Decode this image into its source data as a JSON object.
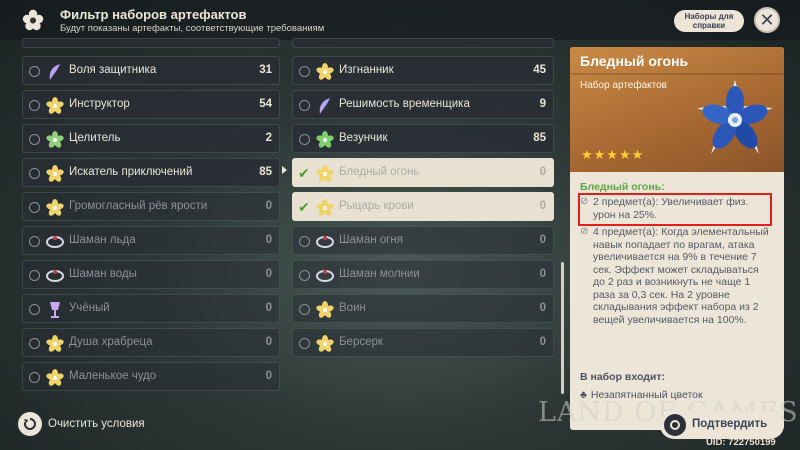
{
  "header": {
    "title": "Фильтр наборов артефактов",
    "subtitle": "Будут показаны артефакты, соответствующие требованиям",
    "help_label": "Наборы для справки",
    "app_icon": "flower-icon",
    "close_icon": "close-icon"
  },
  "left_list": [
    {
      "label": "Воля защитника",
      "count": "31",
      "icon": "feather-icon",
      "state": "normal"
    },
    {
      "label": "Инструктор",
      "count": "54",
      "icon": "flower-icon",
      "state": "normal"
    },
    {
      "label": "Целитель",
      "count": "2",
      "icon": "leaf-icon",
      "state": "normal"
    },
    {
      "label": "Искатель приключений",
      "count": "85",
      "icon": "flower-icon",
      "state": "normal"
    },
    {
      "label": "Громогласный рёв ярости",
      "count": "0",
      "icon": "flower-icon",
      "state": "disabled"
    },
    {
      "label": "Шаман льда",
      "count": "0",
      "icon": "circlet-icon",
      "state": "disabled"
    },
    {
      "label": "Шаман воды",
      "count": "0",
      "icon": "circlet-icon",
      "state": "disabled"
    },
    {
      "label": "Учёный",
      "count": "0",
      "icon": "goblet-icon",
      "state": "disabled"
    },
    {
      "label": "Душа храбреца",
      "count": "0",
      "icon": "flower-icon",
      "state": "disabled"
    },
    {
      "label": "Маленькое чудо",
      "count": "0",
      "icon": "flower-icon",
      "state": "disabled"
    }
  ],
  "right_list": [
    {
      "label": "Изгнанник",
      "count": "45",
      "icon": "flower-icon",
      "state": "normal"
    },
    {
      "label": "Решимость временщика",
      "count": "9",
      "icon": "feather-icon",
      "state": "normal"
    },
    {
      "label": "Везунчик",
      "count": "85",
      "icon": "clover-icon",
      "state": "normal"
    },
    {
      "label": "Бледный огонь",
      "count": "0",
      "icon": "flower-icon",
      "state": "selected"
    },
    {
      "label": "Рыцарь крови",
      "count": "0",
      "icon": "flower-icon",
      "state": "selected"
    },
    {
      "label": "Шаман огня",
      "count": "0",
      "icon": "circlet-icon",
      "state": "disabled"
    },
    {
      "label": "Шаман молнии",
      "count": "0",
      "icon": "circlet-icon",
      "state": "disabled"
    },
    {
      "label": "Воин",
      "count": "0",
      "icon": "flower-icon",
      "state": "disabled"
    },
    {
      "label": "Берсерк",
      "count": "0",
      "icon": "flower-icon",
      "state": "disabled"
    }
  ],
  "footer": {
    "clear_label": "Очистить условия",
    "confirm_label": "Подтвердить",
    "uid": "UID: 722750199",
    "watermark": "LAND OF GAMES"
  },
  "detail": {
    "set_name": "Бледный огонь",
    "set_type": "Набор артефактов",
    "stars": "★★★★★",
    "rarity": 5,
    "bonus_header": "Бледный огонь:",
    "bonus_2pc": "2 предмет(а): Увеличивает физ. урон на 25%.",
    "bonus_4pc": "4 предмет(а): Когда элементальный навык попадает по врагам, атака увеличивается на 9% в течение 7 сек. Эффект может складываться до 2 раз и возникнуть не чаще 1 раза за 0,3 сек. На 2 уровне складывания эффект набора из 2 вещей увеличивается на 100%.",
    "includes_label": "В набор входит:",
    "piece_1": "Незапятнанный цветок"
  },
  "colors": {
    "accent_green": "#5ea744",
    "panel_bg": "#ece5d8",
    "header_gold": "#b7763a",
    "highlight_red": "#e0201b",
    "star": "#ffcc33"
  }
}
